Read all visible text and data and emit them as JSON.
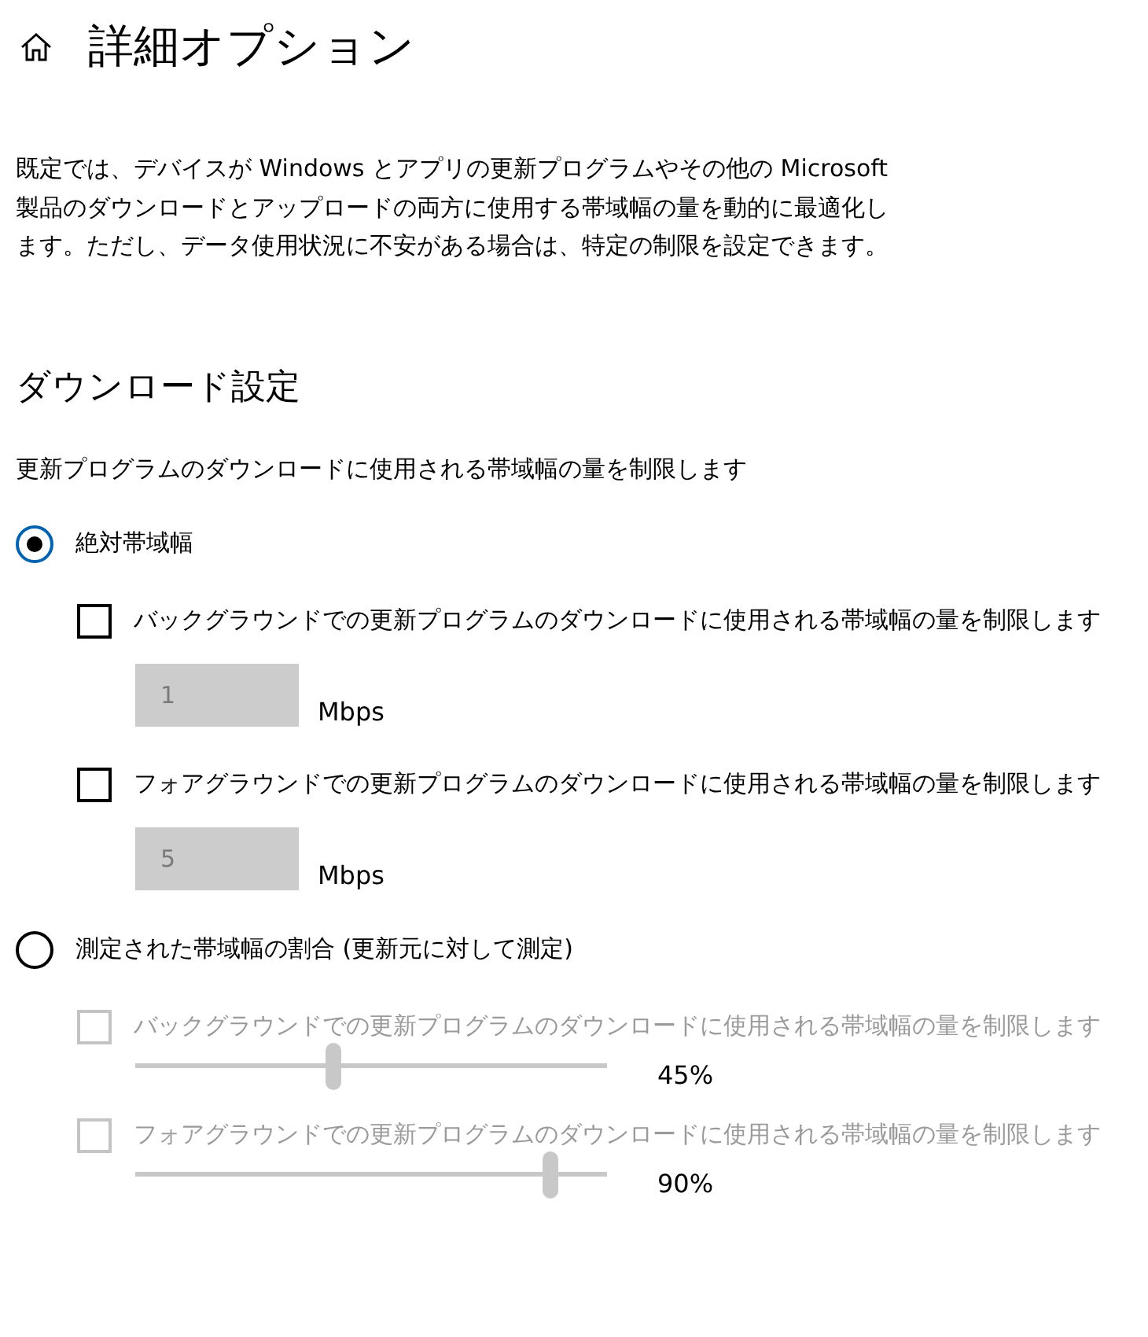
{
  "title": "詳細オプション",
  "description": "既定では、デバイスが Windows とアプリの更新プログラムやその他の Microsoft 製品のダウンロードとアップロードの両方に使用する帯域幅の量を動的に最適化します。ただし、データ使用状況に不安がある場合は、特定の制限を設定できます。",
  "section": {
    "heading": "ダウンロード設定",
    "subtitle": "更新プログラムのダウンロードに使用される帯域幅の量を制限します",
    "options": [
      {
        "label": "絶対帯域幅",
        "selected": true,
        "limits": [
          {
            "kind": "input",
            "label": "バックグラウンドでの更新プログラムのダウンロードに使用される帯域幅の量を制限します",
            "checked": false,
            "disabled": false,
            "value": "1",
            "unit": "Mbps"
          },
          {
            "kind": "input",
            "label": "フォアグラウンドでの更新プログラムのダウンロードに使用される帯域幅の量を制限します",
            "checked": false,
            "disabled": false,
            "value": "5",
            "unit": "Mbps"
          }
        ]
      },
      {
        "label": "測定された帯域幅の割合 (更新元に対して測定)",
        "selected": false,
        "limits": [
          {
            "kind": "slider",
            "label": "バックグラウンドでの更新プログラムのダウンロードに使用される帯域幅の量を制限します",
            "checked": false,
            "disabled": true,
            "level": 0.42,
            "reading": "45%"
          },
          {
            "kind": "slider",
            "label": "フォアグラウンドでの更新プログラムのダウンロードに使用される帯域幅の量を制限します",
            "checked": false,
            "disabled": true,
            "level": 0.88,
            "reading": "90%"
          }
        ]
      }
    ]
  }
}
